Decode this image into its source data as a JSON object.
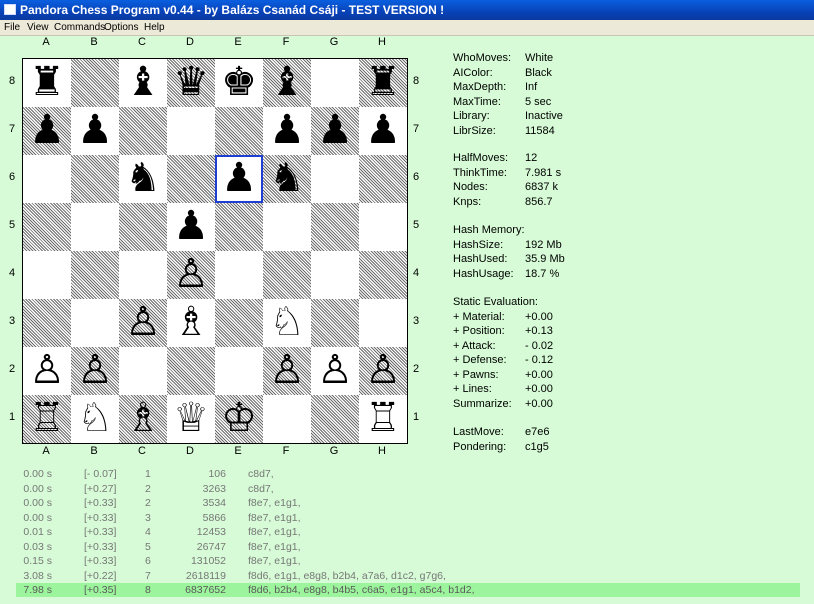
{
  "window": {
    "title": "Pandora Chess Program v0.44 - by Balázs Csanád Csáji - TEST VERSION !"
  },
  "menu": [
    "File",
    "View",
    "Commands",
    "Options",
    "Help"
  ],
  "board": {
    "files": [
      "A",
      "B",
      "C",
      "D",
      "E",
      "F",
      "G",
      "H"
    ],
    "ranks": [
      "8",
      "7",
      "6",
      "5",
      "4",
      "3",
      "2",
      "1"
    ],
    "highlight": "e6",
    "highlight_color": "#1e3fd1",
    "pieces": {
      "a8": "br",
      "b8": "",
      "c8": "bb",
      "d8": "bq",
      "e8": "bk",
      "f8": "bb",
      "g8": "",
      "h8": "br",
      "a7": "bp",
      "b7": "bp",
      "c7": "",
      "d7": "",
      "e7": "",
      "f7": "bp",
      "g7": "bp",
      "h7": "bp",
      "a6": "",
      "b6": "",
      "c6": "bn",
      "d6": "",
      "e6": "bp",
      "f6": "bn",
      "g6": "",
      "h6": "",
      "a5": "",
      "b5": "",
      "c5": "",
      "d5": "bp",
      "e5": "",
      "f5": "",
      "g5": "",
      "h5": "",
      "a4": "",
      "b4": "",
      "c4": "",
      "d4": "wp",
      "e4": "",
      "f4": "",
      "g4": "",
      "h4": "",
      "a3": "",
      "b3": "",
      "c3": "wp",
      "d3": "wb",
      "e3": "",
      "f3": "wn",
      "g3": "",
      "h3": "",
      "a2": "wp",
      "b2": "wp",
      "c2": "",
      "d2": "",
      "e2": "",
      "f2": "wp",
      "g2": "wp",
      "h2": "wp",
      "a1": "wr",
      "b1": "wn",
      "c1": "wb",
      "d1": "wq",
      "e1": "wk",
      "f1": "",
      "g1": "",
      "h1": "wr"
    }
  },
  "info": {
    "groups": [
      [
        {
          "label": "WhoMoves:",
          "value": "White"
        },
        {
          "label": "AIColor:",
          "value": "Black"
        },
        {
          "label": "MaxDepth:",
          "value": "Inf"
        },
        {
          "label": "MaxTime:",
          "value": "5 sec"
        },
        {
          "label": "Library:",
          "value": "Inactive"
        },
        {
          "label": "LibrSize:",
          "value": "11584"
        }
      ],
      [
        {
          "label": "HalfMoves:",
          "value": "12"
        },
        {
          "label": "ThinkTime:",
          "value": "7.981 s"
        },
        {
          "label": "Nodes:",
          "value": "6837 k"
        },
        {
          "label": "Knps:",
          "value": "856.7"
        }
      ],
      [
        {
          "label": "Hash Memory:",
          "value": ""
        },
        {
          "label": "HashSize:",
          "value": "192 Mb"
        },
        {
          "label": "HashUsed:",
          "value": "35.9 Mb"
        },
        {
          "label": "HashUsage:",
          "value": "18.7 %"
        }
      ],
      [
        {
          "label": "Static Evaluation:",
          "value": ""
        },
        {
          "label": "+ Material:",
          "value": "+0.00"
        },
        {
          "label": "+ Position:",
          "value": "+0.13"
        },
        {
          "label": "+ Attack:",
          "value": "- 0.02"
        },
        {
          "label": "+ Defense:",
          "value": "- 0.12"
        },
        {
          "label": "+ Pawns:",
          "value": "+0.00"
        },
        {
          "label": "+ Lines:",
          "value": "+0.00"
        },
        {
          "label": "Summarize:",
          "value": "+0.00"
        }
      ],
      [
        {
          "label": "LastMove:",
          "value": "e7e6"
        },
        {
          "label": "Pondering:",
          "value": "c1g5"
        }
      ]
    ]
  },
  "log": [
    {
      "time": "0.00 s",
      "score": "[- 0.07]",
      "depth": "1",
      "nodes": "106",
      "pv": "c8d7,"
    },
    {
      "time": "0.00 s",
      "score": "[+0.27]",
      "depth": "2",
      "nodes": "3263",
      "pv": "c8d7,"
    },
    {
      "time": "0.00 s",
      "score": "[+0.33]",
      "depth": "2",
      "nodes": "3534",
      "pv": "f8e7, e1g1,"
    },
    {
      "time": "0.00 s",
      "score": "[+0.33]",
      "depth": "3",
      "nodes": "5866",
      "pv": "f8e7, e1g1,"
    },
    {
      "time": "0.01 s",
      "score": "[+0.33]",
      "depth": "4",
      "nodes": "12453",
      "pv": "f8e7, e1g1,"
    },
    {
      "time": "0.03 s",
      "score": "[+0.33]",
      "depth": "5",
      "nodes": "26747",
      "pv": "f8e7, e1g1,"
    },
    {
      "time": "0.15 s",
      "score": "[+0.33]",
      "depth": "6",
      "nodes": "131052",
      "pv": "f8e7, e1g1,"
    },
    {
      "time": "3.08 s",
      "score": "[+0.22]",
      "depth": "7",
      "nodes": "2618119",
      "pv": "f8d6, e1g1, e8g8, b2b4, a7a6, d1c2, g7g6,"
    },
    {
      "time": "7.98 s",
      "score": "[+0.35]",
      "depth": "8",
      "nodes": "6837652",
      "pv": "f8d6, b2b4, e8g8, b4b5, c6a5, e1g1, a5c4, b1d2,"
    }
  ]
}
